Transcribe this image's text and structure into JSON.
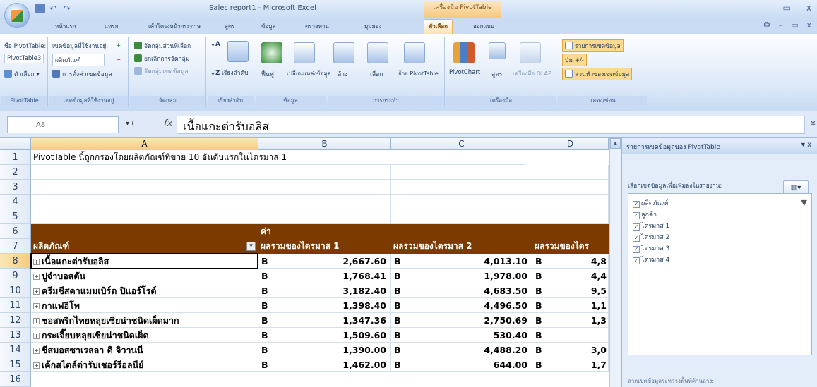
{
  "window": {
    "title": "Sales report1 - Microsoft Excel",
    "context_title": "เครื่องมือ PivotTable",
    "minimize": "–",
    "restore": "▭",
    "close": "x"
  },
  "qat": {
    "undo": "↶",
    "redo": "↷"
  },
  "tabs": [
    "หน้าแรก",
    "แทรก",
    "เค้าโครงหน้ากระดาษ",
    "สูตร",
    "ข้อมูล",
    "ตรวจทาน",
    "มุมมอง",
    "ตัวเลือก",
    "ออกแบบ"
  ],
  "active_tab_index": 7,
  "ribbon": {
    "pivottable": {
      "name_label": "ชื่อ PivotTable:",
      "name_value": "PivotTable3",
      "options": "ตัวเลือก",
      "group": "PivotTable"
    },
    "active_field": {
      "label": "เขตข้อมูลที่ใช้งานอยู่:",
      "value": "ผลิตภัณฑ์",
      "settings": "การตั้งค่าเขตข้อมูล",
      "group": "เขตข้อมูลที่ใช้งานอยู่"
    },
    "group_grp": {
      "items": [
        "จัดกลุ่มส่วนที่เลือก",
        "ยกเลิกการจัดกลุ่ม",
        "จัดกลุ่มเขตข้อมูล"
      ],
      "group": "จัดกลุ่ม"
    },
    "sort": {
      "label": "เรียงลำดับ",
      "group": "เรียงลำดับ"
    },
    "data": {
      "refresh": "ฟื้นฟู",
      "change_source": "เปลี่ยนแหล่งข้อมูล",
      "group": "ข้อมูล"
    },
    "actions": {
      "clear": "ล้าง",
      "select": "เลือก",
      "move": "ย้าย PivotTable",
      "group": "การกระทำ"
    },
    "tools": {
      "pivotchart": "PivotChart",
      "formula": "สูตร",
      "olap": "เครื่องมือ OLAP",
      "group": "เครื่องมือ"
    },
    "show_hide": {
      "field_list": "รายการเขตข้อมูล",
      "buttons": "ปุ่ม +/-",
      "headers": "ส่วนหัวของเขตข้อมูล",
      "group": "แสดง/ซ่อน"
    }
  },
  "formula_bar": {
    "name_box": "A8",
    "fx": "fx",
    "value": "เนื้อแกะต่ารับอลิส"
  },
  "columns": [
    "A",
    "B",
    "C",
    "D"
  ],
  "rows": [
    "1",
    "2",
    "3",
    "4",
    "5",
    "6",
    "7",
    "8",
    "9",
    "10",
    "11",
    "12",
    "13",
    "14",
    "15",
    "16"
  ],
  "sheet": {
    "a1": "PivotTable นี้ถูกกรองโดยผลิตภัณฑ์ที่ขาย 10 อันดับแรกในไตรมาส 1",
    "b6": "ค่า",
    "a7": "ผลิตภัณฑ์",
    "b7": "ผลรวมของไตรมาส 1",
    "c7": "ผลรวมของไตรมาส 2",
    "d7": "ผลรวมของไตร",
    "data_rows": [
      {
        "name": "เนื้อแกะต่ารับอลิส",
        "b": "B",
        "q1": "2,667.60",
        "c": "B",
        "q2": "4,013.10",
        "d": "4,8"
      },
      {
        "name": "ปูจำบอสตัน",
        "b": "B",
        "q1": "1,768.41",
        "c": "B",
        "q2": "1,978.00",
        "d": "4,4"
      },
      {
        "name": "ครีมชีสคาแมมเบิร์ต ปิแอร์โรต์",
        "b": "B",
        "q1": "3,182.40",
        "c": "B",
        "q2": "4,683.50",
        "d": "9,5"
      },
      {
        "name": "กาแฟอีโพ",
        "b": "B",
        "q1": "1,398.40",
        "c": "B",
        "q2": "4,496.50",
        "d": "1,1"
      },
      {
        "name": "ซอสพริกไทยหลุยเซียน่าชนิดเผ็ดมาก",
        "b": "B",
        "q1": "1,347.36",
        "c": "B",
        "q2": "2,750.69",
        "d": "1,3"
      },
      {
        "name": "กระเจี๊ยบหลุยเซียน่าชนิดเผ็ด",
        "b": "B",
        "q1": "1,509.60",
        "c": "B",
        "q2": "530.40",
        "d": ""
      },
      {
        "name": "ชีสมอสซาเรลลา ดิ จิวานนี",
        "b": "B",
        "q1": "1,390.00",
        "c": "B",
        "q2": "4,488.20",
        "d": "3,0"
      },
      {
        "name": "เค้กสไตล์ต่ารับเชอร์รีอลนีย์",
        "b": "B",
        "q1": "1,462.00",
        "c": "B",
        "q2": "644.00",
        "d": "1,7"
      }
    ]
  },
  "field_pane": {
    "title": "รายการเขตข้อมูลของ PivotTable",
    "close": "▾ x",
    "subtitle": "เลือกเขตข้อมูลเพื่อเพิ่มลงในรายงาน:",
    "layout": "▥▾",
    "fields": [
      "ผลิตภัณฑ์",
      "ลูกค้า",
      "ไตรมาส 1",
      "ไตรมาส 2",
      "ไตรมาส 3",
      "ไตรมาส 4"
    ],
    "bottom_text": "ลากเขตข้อมูลระหว่างพื้นที่ด้านล่าง:"
  }
}
